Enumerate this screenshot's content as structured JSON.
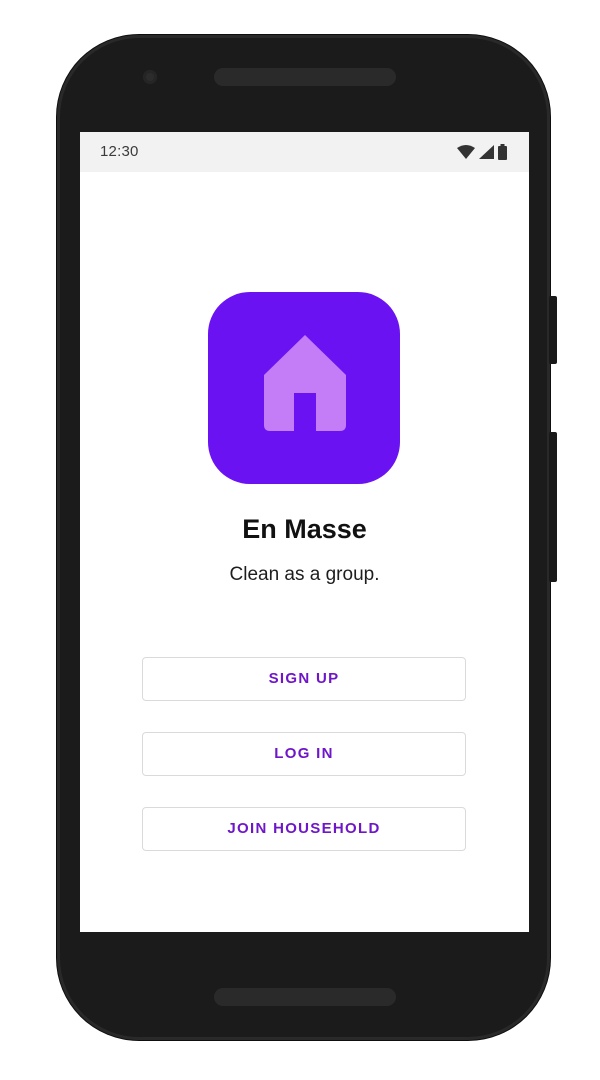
{
  "status_bar": {
    "time": "12:30",
    "icons": [
      "wifi-icon",
      "signal-icon",
      "battery-icon"
    ]
  },
  "app": {
    "icon": "home-icon",
    "title": "En Masse",
    "tagline": "Clean as a group."
  },
  "actions": {
    "sign_up_label": "SIGN UP",
    "log_in_label": "LOG IN",
    "join_household_label": "JOIN HOUSEHOLD"
  },
  "colors": {
    "accent": "#6a12f2",
    "icon_glyph": "#c57cf7",
    "button_text": "#6f16c9",
    "status_bar_bg": "#f2f2f2",
    "phone_body": "#1c1b1c"
  }
}
